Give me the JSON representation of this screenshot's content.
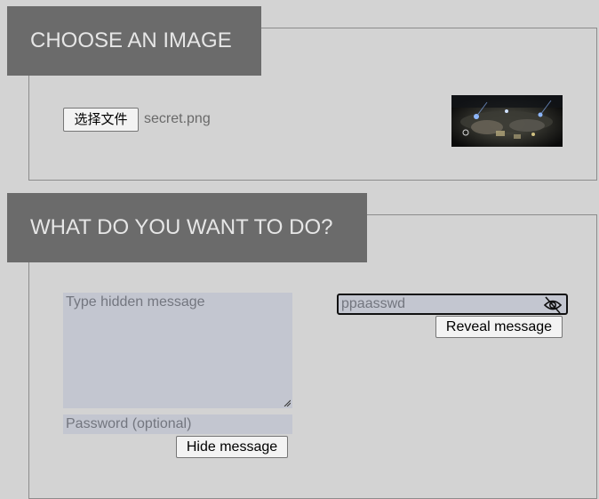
{
  "choose_section": {
    "title": "CHOOSE AN IMAGE",
    "file_button_label": "选择文件",
    "file_name": "secret.png"
  },
  "action_section": {
    "title": "WHAT DO YOU WANT TO DO?",
    "message_placeholder": "Type hidden message",
    "password_placeholder": "Password (optional)",
    "hide_button_label": "Hide message",
    "reveal_password_value": "ppaasswd",
    "reveal_button_label": "Reveal message"
  },
  "icons": {
    "visibility_toggle": "eye-off-icon",
    "resize": "resize-handle-icon"
  },
  "colors": {
    "background": "#d3d3d3",
    "header_bg": "#6b6b6b",
    "header_text": "#e6e6e6",
    "field_bg": "#c3c6d0"
  }
}
